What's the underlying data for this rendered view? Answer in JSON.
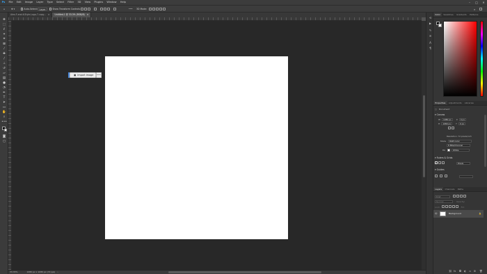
{
  "menubar": {
    "app_icon": "photoshop-logo",
    "items": [
      "File",
      "Edit",
      "Image",
      "Layer",
      "Type",
      "Select",
      "Filter",
      "3D",
      "View",
      "Plugins",
      "Window",
      "Help"
    ],
    "window_buttons": [
      "–",
      "□",
      "✕"
    ]
  },
  "options": {
    "auto_select_label": "Auto-Select:",
    "auto_select_value": "Layer",
    "show_transform_label": "Show Transform Controls",
    "mode_3d_label": "3D Mode:",
    "more": "•••"
  },
  "tabs": [
    {
      "label": "Alex-F-and-K-Style-Logo-7-copy..."
    },
    {
      "label": "Untitled-1 @ 33.3% (RGB/8)"
    }
  ],
  "tab_close": "×",
  "canvas": {
    "import_button_label": "Import image",
    "import_more": "•••"
  },
  "status": {
    "zoom": "33.33%",
    "doc_info": "1080 px x 1080 px (72 ppi)",
    "arrow": "›"
  },
  "panels": {
    "color_tabs": [
      "Color",
      "Swatches",
      "Gradients",
      "Patterns"
    ],
    "color": {
      "foreground": "#000000",
      "background": "#ffffff",
      "field_hue": "#ff0000"
    },
    "properties_tabs": [
      "Properties",
      "Adjustments",
      "Libraries"
    ],
    "doc_label": "Document",
    "canvas_header": "Canvas",
    "w_label": "W",
    "w_value": "1080 px",
    "h_label": "H",
    "h_value": "1080 px",
    "x_label": "X",
    "x_value": "0 px",
    "y_label": "Y",
    "y_value": "0 px",
    "resolution": "Resolution: 72 pixels/inch",
    "mode_label": "Mode",
    "mode_value": "RGB Color",
    "depth_value": "8 Bits/Channel",
    "fill_label": "Fill",
    "fill_value": "White",
    "rulers_header": "Rulers & Grids",
    "rulers_unit": "Pixels",
    "guides_header": "Guides",
    "layers_tabs": [
      "Layers",
      "Channels",
      "Paths"
    ],
    "layer_kind": "Kind",
    "layer_blend": "Normal",
    "layer_opacity": "Opacity:",
    "layer_lock": "Lock:",
    "layer_fill": "Fill:",
    "layer_name": "Background",
    "layer_lock_icon": "🔒"
  }
}
